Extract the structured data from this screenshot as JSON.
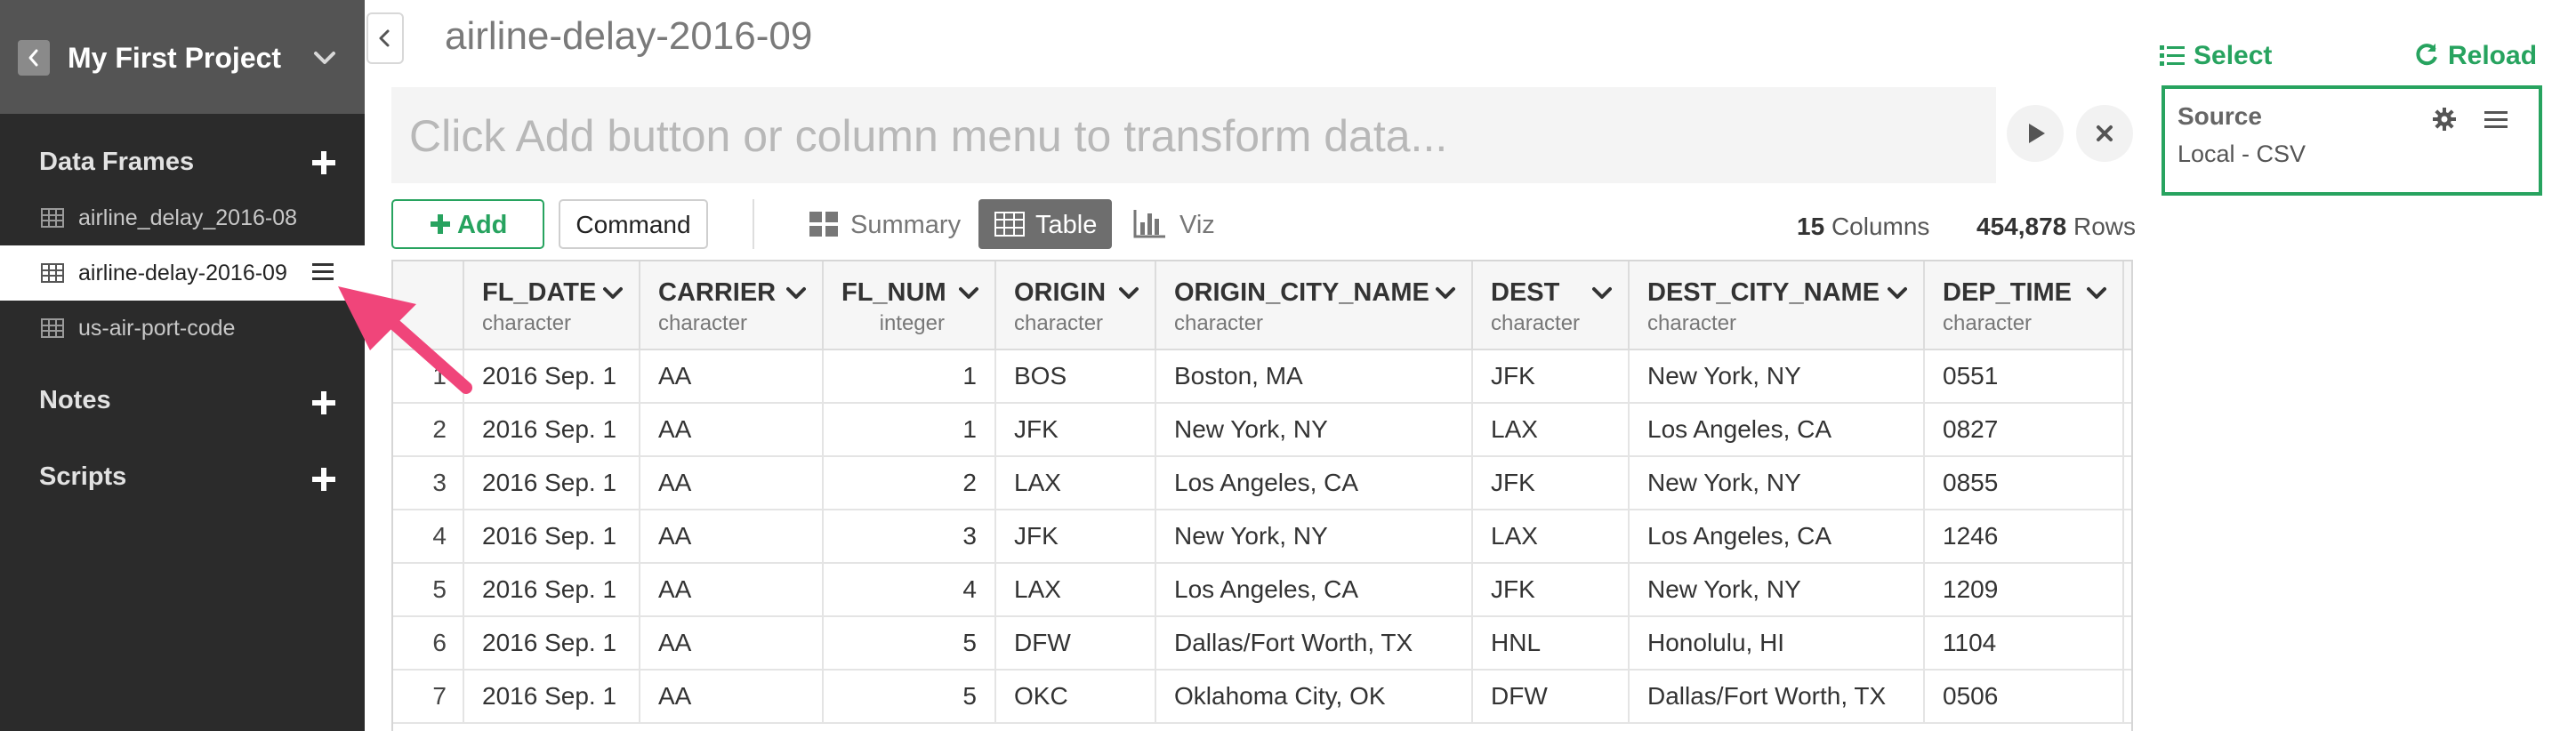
{
  "sidebar": {
    "project_title": "My First Project",
    "sections": {
      "data_frames": "Data Frames",
      "notes": "Notes",
      "scripts": "Scripts"
    },
    "data_frames": [
      {
        "label": "airline_delay_2016-08",
        "active": false
      },
      {
        "label": "airline-delay-2016-09",
        "active": true
      },
      {
        "label": "us-air-port-code",
        "active": false
      }
    ]
  },
  "main": {
    "title": "airline-delay-2016-09",
    "command_placeholder": "Click Add button or column menu to transform data...",
    "add_label": "Add",
    "command_label": "Command",
    "views": {
      "summary": "Summary",
      "table": "Table",
      "viz": "Viz"
    },
    "active_view": "table",
    "counts": {
      "columns": "15",
      "columns_label": "Columns",
      "rows": "454,878",
      "rows_label": "Rows"
    }
  },
  "table": {
    "columns": [
      {
        "name": "FL_DATE",
        "type": "character"
      },
      {
        "name": "CARRIER",
        "type": "character"
      },
      {
        "name": "FL_NUM",
        "type": "integer"
      },
      {
        "name": "ORIGIN",
        "type": "character"
      },
      {
        "name": "ORIGIN_CITY_NAME",
        "type": "character"
      },
      {
        "name": "DEST",
        "type": "character"
      },
      {
        "name": "DEST_CITY_NAME",
        "type": "character"
      },
      {
        "name": "DEP_TIME",
        "type": "character"
      }
    ],
    "rows": [
      [
        "1",
        "2016 Sep. 1",
        "AA",
        "1",
        "BOS",
        "Boston, MA",
        "JFK",
        "New York, NY",
        "0551"
      ],
      [
        "2",
        "2016 Sep. 1",
        "AA",
        "1",
        "JFK",
        "New York, NY",
        "LAX",
        "Los Angeles, CA",
        "0827"
      ],
      [
        "3",
        "2016 Sep. 1",
        "AA",
        "2",
        "LAX",
        "Los Angeles, CA",
        "JFK",
        "New York, NY",
        "0855"
      ],
      [
        "4",
        "2016 Sep. 1",
        "AA",
        "3",
        "JFK",
        "New York, NY",
        "LAX",
        "Los Angeles, CA",
        "1246"
      ],
      [
        "5",
        "2016 Sep. 1",
        "AA",
        "4",
        "LAX",
        "Los Angeles, CA",
        "JFK",
        "New York, NY",
        "1209"
      ],
      [
        "6",
        "2016 Sep. 1",
        "AA",
        "5",
        "DFW",
        "Dallas/Fort Worth, TX",
        "HNL",
        "Honolulu, HI",
        "1104"
      ],
      [
        "7",
        "2016 Sep. 1",
        "AA",
        "5",
        "OKC",
        "Oklahoma City, OK",
        "DFW",
        "Dallas/Fort Worth, TX",
        "0506"
      ]
    ]
  },
  "right_panel": {
    "select_label": "Select",
    "reload_label": "Reload",
    "source_title": "Source",
    "source_subtitle": "Local - CSV"
  },
  "colors": {
    "accent": "#27a35f",
    "sidebar_bg": "#2b2b2b",
    "project_header_bg": "#545454",
    "pointer_arrow": "#f0457a"
  },
  "icons": {
    "back": "chevron-left-icon",
    "project_menu": "chevron-down-icon",
    "add_section": "plus-icon",
    "data_frame": "table-grid-icon",
    "data_frame_menu": "hamburger-menu-icon",
    "run": "play-icon",
    "clear": "close-icon",
    "summary": "summary-grid-icon",
    "table": "table-grid-icon",
    "viz": "bar-chart-icon",
    "column_menu": "caret-down-icon",
    "select": "list-icon",
    "reload": "refresh-icon",
    "source_settings": "gear-icon",
    "source_menu": "hamburger-menu-icon"
  }
}
